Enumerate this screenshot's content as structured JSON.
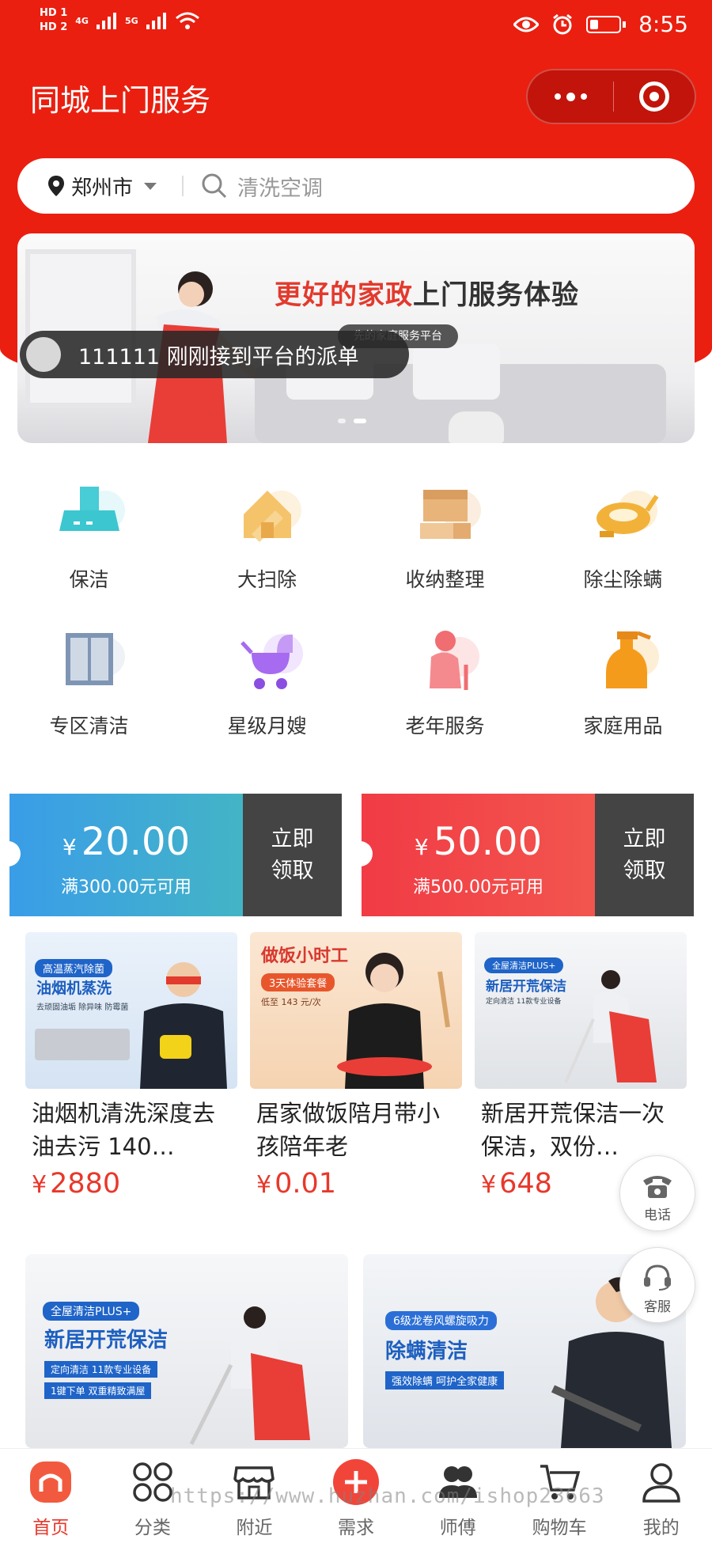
{
  "status_bar": {
    "hd1": "HD 1",
    "hd2": "HD 2",
    "net1": "4G",
    "net2": "5G",
    "time": "8:55"
  },
  "header": {
    "title": "同城上门服务"
  },
  "search": {
    "city": "郑州市",
    "placeholder": "清洗空调"
  },
  "banner": {
    "headline_red": "更好的家政",
    "headline_dark": "上门服务体验",
    "subline": "先的家庭服务平台"
  },
  "toast": {
    "text": "111111 刚刚接到平台的派单"
  },
  "categories": [
    {
      "label": "保洁",
      "icon": "range-hood-icon",
      "color": "#3cc6d0"
    },
    {
      "label": "大扫除",
      "icon": "house-broom-icon",
      "color": "#f5c36a"
    },
    {
      "label": "收纳整理",
      "icon": "storage-box-icon",
      "color": "#e8b47a"
    },
    {
      "label": "除尘除螨",
      "icon": "vacuum-icon",
      "color": "#f2b23a"
    },
    {
      "label": "专区清洁",
      "icon": "window-icon",
      "color": "#7f95b4"
    },
    {
      "label": "星级月嫂",
      "icon": "baby-stroller-icon",
      "color": "#a66bf0"
    },
    {
      "label": "老年服务",
      "icon": "elderly-icon",
      "color": "#f06d72"
    },
    {
      "label": "家庭用品",
      "icon": "spray-bottle-icon",
      "color": "#f59b1c"
    }
  ],
  "coupons": [
    {
      "currency": "¥",
      "amount": "20.00",
      "condition": "满300.00元可用",
      "action_line1": "立即",
      "action_line2": "领取",
      "color_from": "#3a9de8",
      "color_to": "#43b4c6"
    },
    {
      "currency": "¥",
      "amount": "50.00",
      "condition": "满500.00元可用",
      "action_line1": "立即",
      "action_line2": "领取",
      "color_from": "#f13b45",
      "color_to": "#f2554e"
    }
  ],
  "products": [
    {
      "name": "油烟机清洗深度去油去污 140…",
      "currency": "¥",
      "price": "2880",
      "img_title": "油烟机蒸洗",
      "img_tag": "高温蒸汽除菌",
      "img_caption": "去顽固油垢 除异味 防霉菌"
    },
    {
      "name": "居家做饭陪月带小孩陪年老",
      "currency": "¥",
      "price": "0.01",
      "img_title": "做饭小时工",
      "img_tag": "3天体验套餐",
      "img_caption": "低至 143 元/次"
    },
    {
      "name": "新居开荒保洁一次保洁，双份…",
      "currency": "¥",
      "price": "648",
      "img_title": "新居开荒保洁",
      "img_tag": "全屋清洁PLUS+",
      "img_caption": "定向清洁 11款专业设备"
    }
  ],
  "feature_cards": [
    {
      "tag": "全屋清洁PLUS+",
      "title": "新居开荒保洁",
      "line1": "定向清洁 11款专业设备",
      "line2": "1键下单 双重精致满屋"
    },
    {
      "tag": "6级龙卷风螺旋吸力",
      "title": "除螨清洁",
      "line1": "强效除螨 呵护全家健康"
    }
  ],
  "floating": [
    {
      "label": "电话",
      "icon": "telephone-icon"
    },
    {
      "label": "客服",
      "icon": "headset-icon"
    }
  ],
  "tabbar": [
    {
      "label": "首页",
      "icon": "home-icon",
      "active": true
    },
    {
      "label": "分类",
      "icon": "category-grid-icon",
      "active": false
    },
    {
      "label": "附近",
      "icon": "store-icon",
      "active": false
    },
    {
      "label": "需求",
      "icon": "plus-circle-icon",
      "active": false
    },
    {
      "label": "师傅",
      "icon": "workers-icon",
      "active": false
    },
    {
      "label": "购物车",
      "icon": "cart-icon",
      "active": false
    },
    {
      "label": "我的",
      "icon": "profile-icon",
      "active": false
    }
  ],
  "watermark": "https://www.huzhan.com/ishop23663",
  "colors": {
    "primary": "#ea1f10",
    "price": "#e8382b"
  }
}
